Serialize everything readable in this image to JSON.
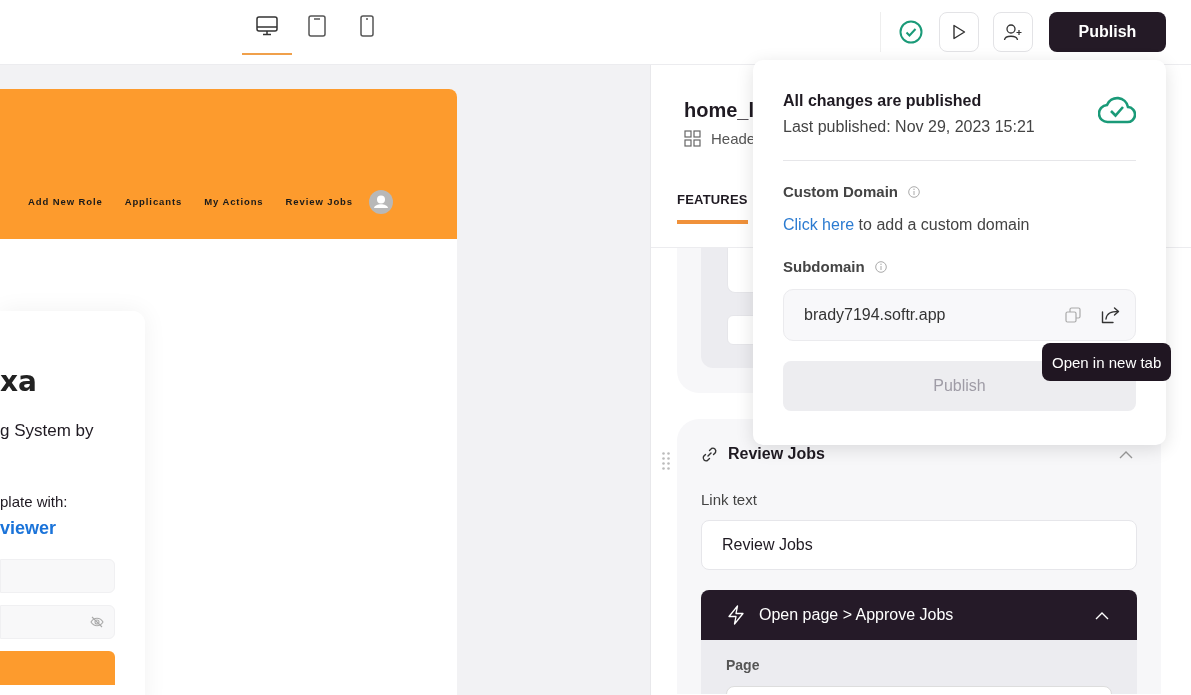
{
  "device_tabs": [
    {
      "kind": "desktop",
      "selected": true
    },
    {
      "kind": "tablet",
      "selected": false
    },
    {
      "kind": "mobile",
      "selected": false
    }
  ],
  "toolbar": {
    "publish_button": "Publish"
  },
  "preview": {
    "nav_links": [
      "Add New Role",
      "Applicants",
      "My Actions",
      "Review Jobs"
    ],
    "logo": "xa",
    "subtitle": "g System by",
    "template_text": "plate with:",
    "link": "viewer"
  },
  "side_panel": {
    "title": "home_l",
    "subtitle": "Heade",
    "tabs": [
      {
        "label": "FEATURES",
        "selected": true
      }
    ],
    "section": {
      "title": "Review Jobs",
      "expanded": true,
      "link_text_label": "Link text",
      "link_text_value": "Review Jobs",
      "action": {
        "label": "Open page > Approve Jobs",
        "expanded": true,
        "page_label": "Page"
      }
    }
  },
  "popover": {
    "status": "All changes are published",
    "last_published": "Last published: Nov 29, 2023 15:21",
    "custom_domain_label": "Custom Domain",
    "custom_domain_link": "Click here",
    "custom_domain_text": "to add a custom domain",
    "subdomain_label": "Subdomain",
    "subdomain_value": "brady7194.softr.app",
    "publish_button": "Publish",
    "publish_disabled": true
  },
  "tooltip": "Open in new tab"
}
